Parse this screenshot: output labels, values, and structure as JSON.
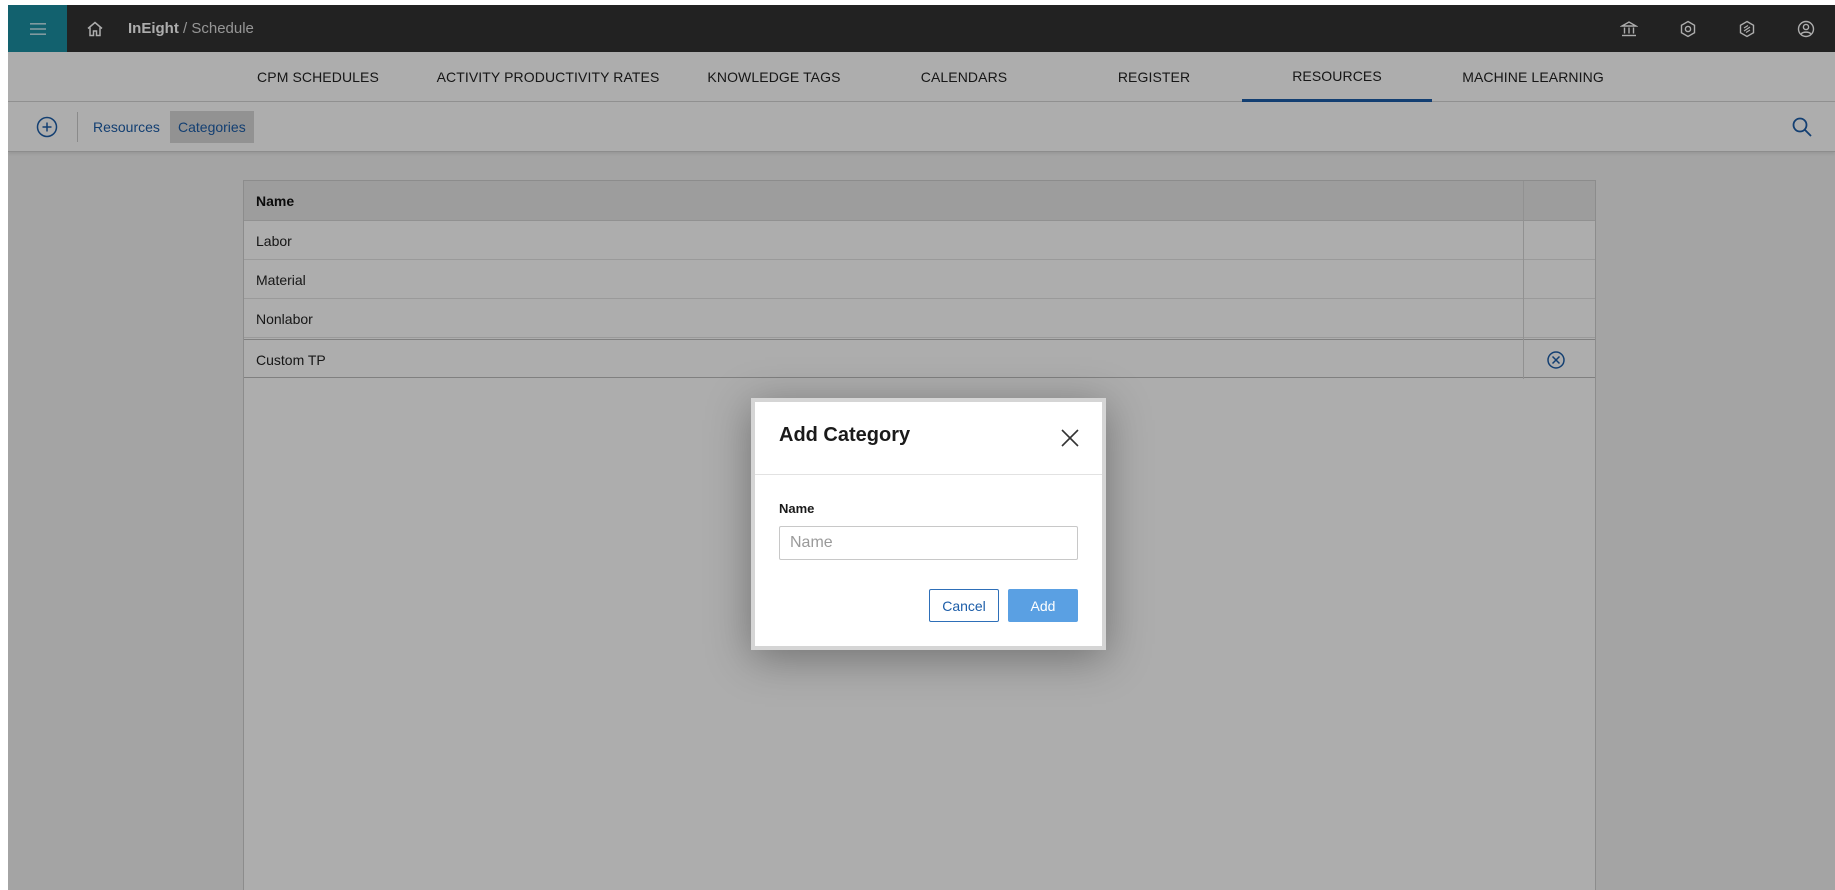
{
  "header": {
    "brand": "InEight",
    "separator": " / ",
    "module": "Schedule",
    "icons": [
      "menu-icon",
      "home-icon",
      "bank-icon",
      "settings-icon",
      "integration-icon",
      "user-icon"
    ]
  },
  "tabs": [
    {
      "label": "CPM SCHEDULES",
      "active": false
    },
    {
      "label": "ACTIVITY PRODUCTIVITY RATES",
      "active": false
    },
    {
      "label": "KNOWLEDGE TAGS",
      "active": false
    },
    {
      "label": "CALENDARS",
      "active": false
    },
    {
      "label": "REGISTER",
      "active": false
    },
    {
      "label": "RESOURCES",
      "active": true
    },
    {
      "label": "MACHINE LEARNING",
      "active": false
    }
  ],
  "toolbar": {
    "breadcrumbs": [
      {
        "label": "Resources",
        "selected": false
      },
      {
        "label": "Categories",
        "selected": true
      }
    ]
  },
  "table": {
    "column_header": "Name",
    "rows": [
      {
        "name": "Labor",
        "removable": false
      },
      {
        "name": "Material",
        "removable": false
      },
      {
        "name": "Nonlabor",
        "removable": false
      },
      {
        "name": "Custom TP",
        "removable": true
      }
    ]
  },
  "modal": {
    "title": "Add Category",
    "field_label": "Name",
    "input_value": "",
    "input_placeholder": "Name",
    "cancel_label": "Cancel",
    "add_label": "Add"
  },
  "colors": {
    "accent": "#1c5da8",
    "menu_button": "#1b8fa3",
    "topbar": "#333333",
    "primary_button": "#5aa0e3"
  }
}
